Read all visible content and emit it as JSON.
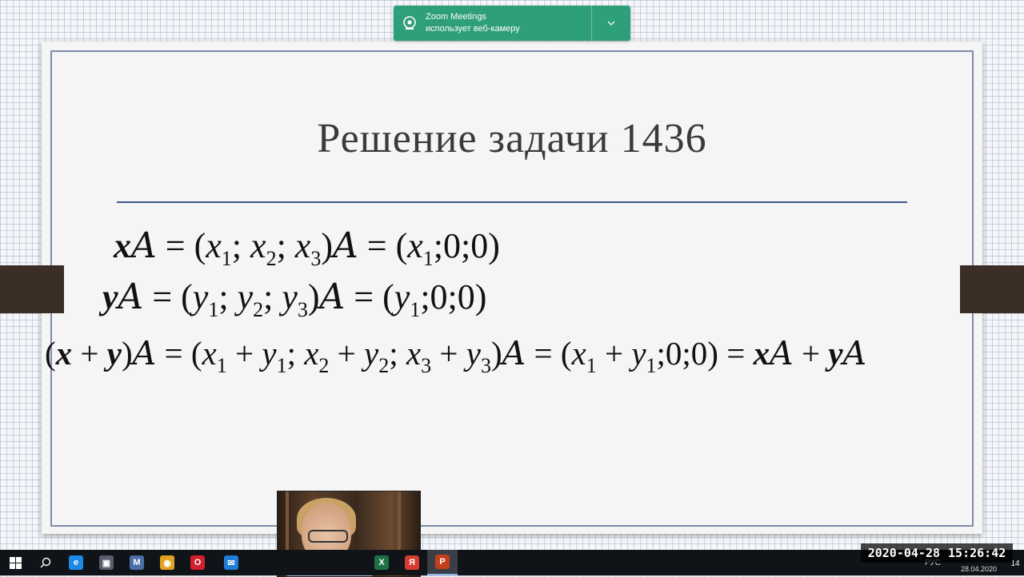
{
  "slide": {
    "title": "Решение задачи 1436",
    "eq1": {
      "lhs_vec": "x",
      "op": "A",
      "eq": "=",
      "lparen": "(",
      "v1": "x",
      "s1": "1",
      "sep": ";",
      "v2": "x",
      "s2": "2",
      "v3": "x",
      "s3": "3",
      "rhs": "(x",
      "rs": "1",
      "rtail": ";0;0)"
    },
    "eq2": {
      "lhs_vec": "y",
      "op": "A",
      "eq": "=",
      "v1": "y",
      "s1": "1",
      "v2": "y",
      "s2": "2",
      "v3": "y",
      "s3": "3",
      "rhs": "(y",
      "rs": "1",
      "rtail": ";0;0)"
    },
    "eq3": {
      "lhs": "(x + y)",
      "op": "A",
      "eq": "=",
      "a1": "x",
      "a1s": "1",
      "b1": "y",
      "b1s": "1",
      "a2": "x",
      "a2s": "2",
      "b2": "y",
      "b2s": "2",
      "a3": "x",
      "a3s": "3",
      "b3": "y",
      "b3s": "3",
      "rx": "x",
      "rxs": "1",
      "ry": "y",
      "rys": "1",
      "tail": ";0;0)",
      "final_x": "x",
      "final_y": "y"
    }
  },
  "zoom_toast": {
    "app_name": "Zoom Meetings",
    "message": "использует веб-камеру",
    "camera_icon": "webcam-icon",
    "chevron_icon": "chevron-down-icon"
  },
  "taskbar": {
    "apps": [
      {
        "name": "search-icon",
        "glyph": "⌕",
        "color": "#101418"
      },
      {
        "name": "edge-icon",
        "glyph": "e",
        "color": "#1e88e5"
      },
      {
        "name": "video-editor-icon",
        "glyph": "▣",
        "color": "#5b5b6e"
      },
      {
        "name": "m-app-icon",
        "glyph": "M",
        "color": "#4a6fa5"
      },
      {
        "name": "chrome-icon",
        "glyph": "◉",
        "color": "#e0a220"
      },
      {
        "name": "opera-icon",
        "glyph": "O",
        "color": "#d1202e"
      },
      {
        "name": "mail-icon",
        "glyph": "✉",
        "color": "#1f7fd6"
      },
      {
        "name": "excel-icon",
        "glyph": "X",
        "color": "#1e7145"
      },
      {
        "name": "yandex-icon",
        "glyph": "Я",
        "color": "#d63b2f"
      },
      {
        "name": "powerpoint-icon",
        "glyph": "P",
        "color": "#c43e1c"
      }
    ],
    "language": "РУС",
    "tray_date": "28.04.2020",
    "notification_count": "14"
  },
  "recording_timestamp": {
    "date": "2020-04-28",
    "time": "15:26:42"
  }
}
